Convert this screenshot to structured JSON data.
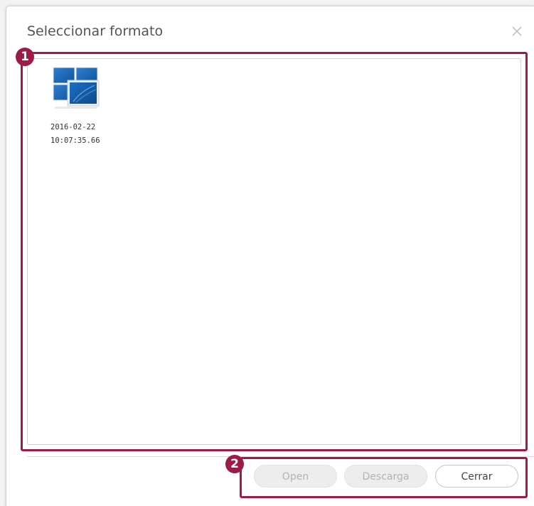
{
  "dialog": {
    "title": "Seleccionar formato",
    "close_icon": "close-icon"
  },
  "files": [
    {
      "icon": "window-layout-icon",
      "date": "2016-02-22",
      "time": "10:07:35.66"
    }
  ],
  "buttons": {
    "open": {
      "label": "Open",
      "enabled": false
    },
    "download": {
      "label": "Descarga",
      "enabled": false
    },
    "close": {
      "label": "Cerrar",
      "enabled": true
    }
  },
  "callouts": [
    "1",
    "2"
  ],
  "colors": {
    "callout": "#9c1b49",
    "icon_blue": "#1e6bb8"
  }
}
